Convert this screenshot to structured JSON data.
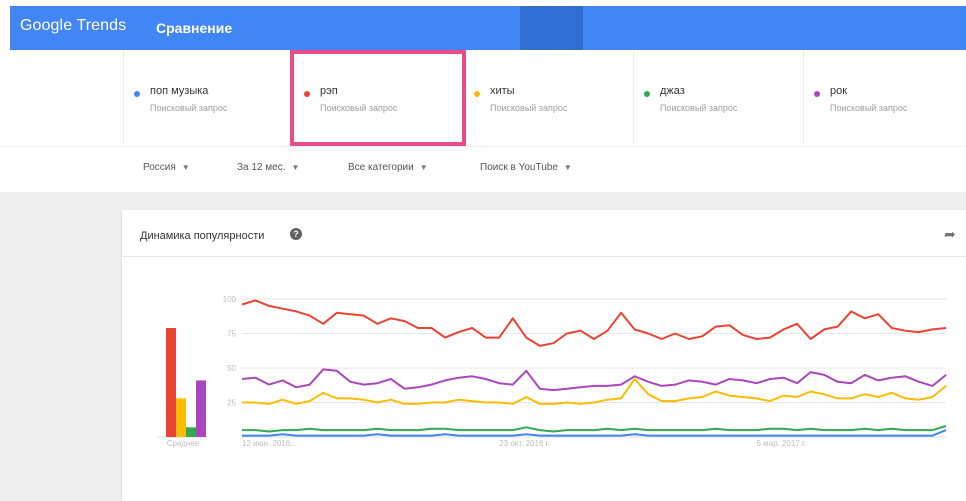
{
  "header": {
    "logo_google": "Google",
    "logo_trends": "Trends",
    "title": "Сравнение"
  },
  "terms": [
    {
      "name": "поп музыка",
      "type": "Поисковый запрос",
      "color": "#4285f4"
    },
    {
      "name": "рэп",
      "type": "Поисковый запрос",
      "color": "#ea4335"
    },
    {
      "name": "хиты",
      "type": "Поисковый запрос",
      "color": "#fbbc04"
    },
    {
      "name": "джаз",
      "type": "Поисковый запрос",
      "color": "#34a853"
    },
    {
      "name": "рок",
      "type": "Поисковый запрос",
      "color": "#ab47bc"
    }
  ],
  "filters": {
    "region": "Россия",
    "period": "За 12 мес.",
    "category": "Все категории",
    "source": "Поиск в YouTube"
  },
  "card": {
    "title": "Динамика популярности",
    "help_icon": "help-icon",
    "share_icon": "share-icon"
  },
  "chart_data": {
    "type": "line",
    "average_label": "Среднее",
    "averages": [
      {
        "series": "поп музыка",
        "value": 1
      },
      {
        "series": "рэп",
        "value": 79
      },
      {
        "series": "хиты",
        "value": 28
      },
      {
        "series": "джаз",
        "value": 7
      },
      {
        "series": "рок",
        "value": 41
      }
    ],
    "y_ticks": [
      100,
      75,
      50,
      25
    ],
    "ylim": [
      0,
      100
    ],
    "x_tick_labels": [
      "12 июн. 2016...",
      "23 окт. 2016 г.",
      "5 мар. 2017 г."
    ],
    "x_tick_positions": [
      0,
      19,
      38
    ],
    "series": [
      {
        "name": "рэп",
        "color": "#ea4335",
        "values": [
          96,
          99,
          95,
          93,
          91,
          88,
          82,
          90,
          89,
          88,
          82,
          86,
          84,
          79,
          79,
          72,
          76,
          79,
          72,
          72,
          86,
          72,
          66,
          68,
          75,
          77,
          71,
          77,
          90,
          78,
          75,
          71,
          75,
          71,
          73,
          80,
          81,
          74,
          71,
          72,
          78,
          82,
          71,
          78,
          80,
          91,
          86,
          89,
          79,
          77,
          76,
          78,
          79
        ]
      },
      {
        "name": "рок",
        "color": "#ab47bc",
        "values": [
          42,
          43,
          38,
          41,
          36,
          38,
          49,
          48,
          40,
          38,
          39,
          42,
          35,
          36,
          38,
          41,
          43,
          44,
          42,
          39,
          38,
          48,
          35,
          34,
          35,
          36,
          37,
          37,
          38,
          44,
          40,
          37,
          38,
          41,
          40,
          38,
          42,
          41,
          39,
          42,
          43,
          39,
          47,
          45,
          40,
          39,
          45,
          41,
          43,
          44,
          40,
          37,
          45
        ]
      },
      {
        "name": "хиты",
        "color": "#fbbc04",
        "values": [
          25,
          25,
          24,
          27,
          24,
          26,
          32,
          28,
          28,
          27,
          25,
          27,
          24,
          24,
          25,
          25,
          27,
          26,
          25,
          25,
          24,
          29,
          24,
          24,
          25,
          24,
          25,
          27,
          28,
          42,
          31,
          26,
          26,
          28,
          29,
          33,
          30,
          29,
          28,
          26,
          30,
          29,
          33,
          31,
          28,
          28,
          31,
          29,
          32,
          28,
          27,
          29,
          37
        ]
      },
      {
        "name": "джаз",
        "color": "#34a853",
        "values": [
          5,
          5,
          4,
          5,
          5,
          6,
          5,
          5,
          5,
          5,
          6,
          5,
          5,
          5,
          6,
          6,
          5,
          5,
          5,
          5,
          5,
          7,
          5,
          4,
          5,
          5,
          5,
          6,
          5,
          6,
          5,
          5,
          5,
          5,
          5,
          6,
          5,
          5,
          5,
          6,
          6,
          5,
          6,
          5,
          5,
          5,
          6,
          5,
          6,
          5,
          5,
          5,
          8
        ]
      },
      {
        "name": "поп музыка",
        "color": "#4285f4",
        "values": [
          1,
          1,
          1,
          2,
          1,
          1,
          1,
          1,
          1,
          1,
          2,
          1,
          1,
          1,
          1,
          2,
          1,
          1,
          1,
          1,
          1,
          2,
          1,
          1,
          1,
          1,
          1,
          1,
          1,
          2,
          1,
          1,
          1,
          1,
          1,
          1,
          1,
          1,
          1,
          1,
          1,
          1,
          1,
          1,
          1,
          1,
          1,
          1,
          1,
          1,
          1,
          1,
          5
        ]
      }
    ]
  }
}
